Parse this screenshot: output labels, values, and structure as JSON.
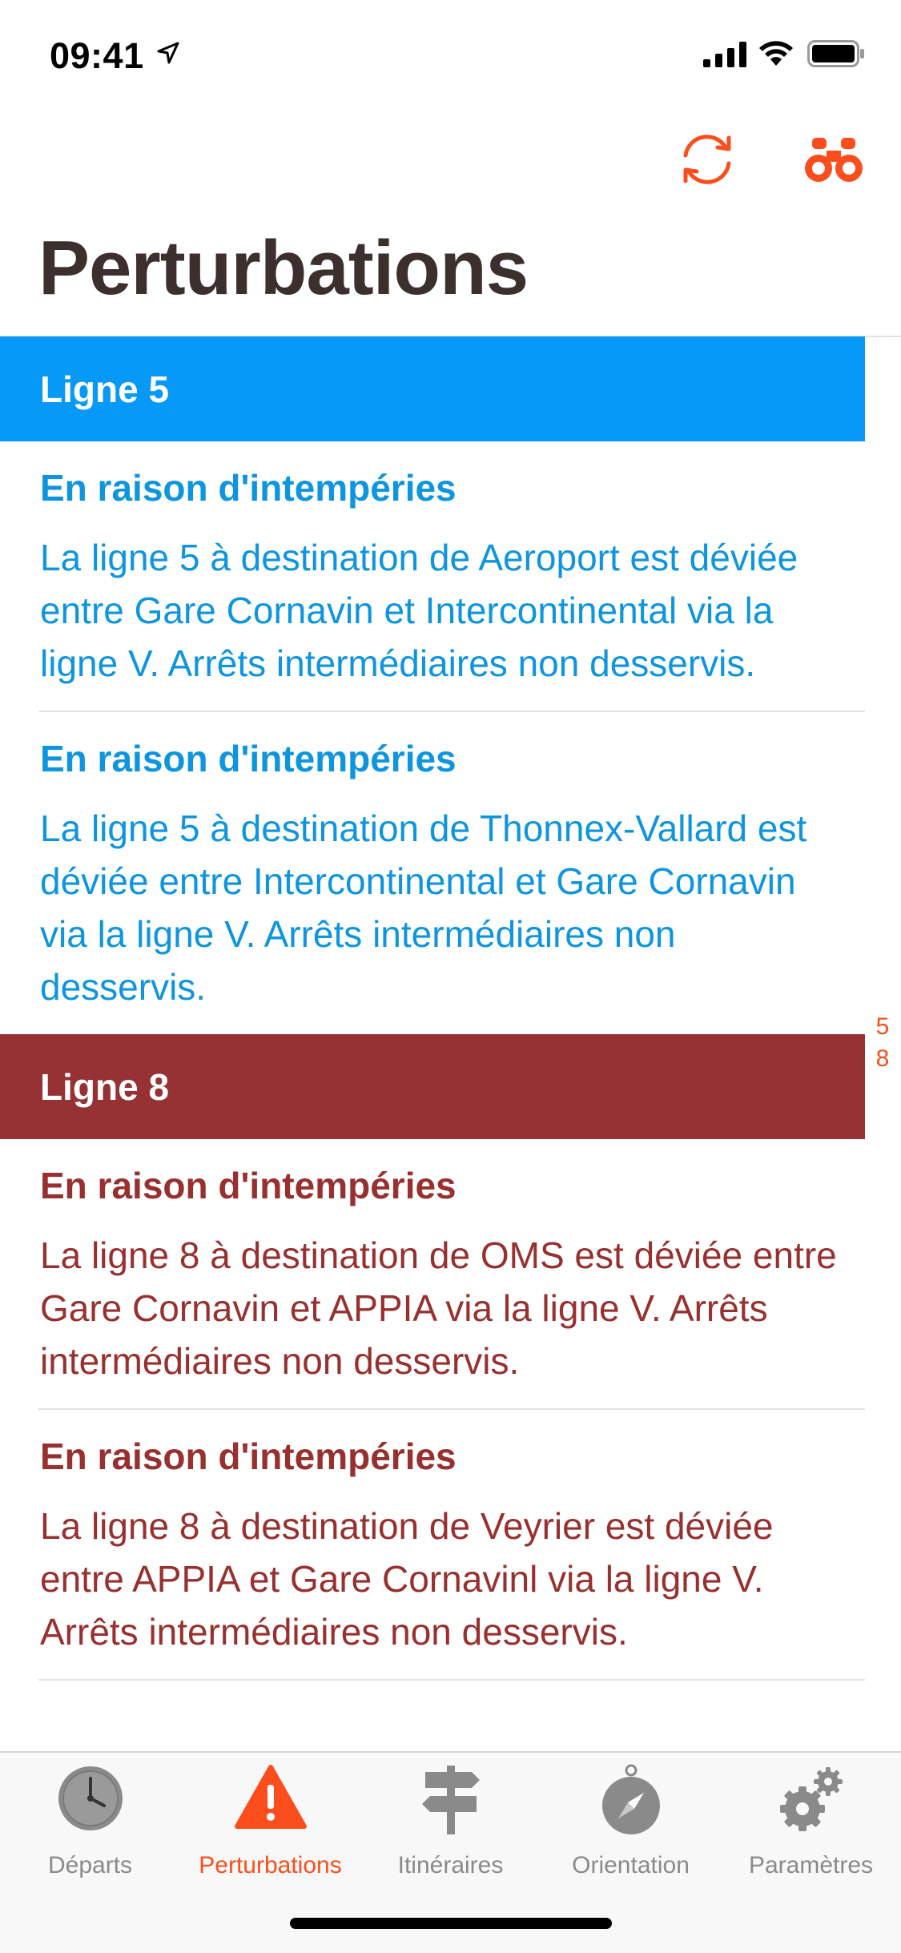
{
  "status_bar": {
    "time": "09:41"
  },
  "colors": {
    "accent": "#fb4e1c",
    "line5": "#0699f7",
    "line8": "#963234",
    "title": "#3b302e",
    "tab_inactive": "#8a8a8a"
  },
  "header": {
    "title": "Perturbations"
  },
  "sections": [
    {
      "label": "Ligne 5",
      "items": [
        {
          "title": "En raison d'intempéries",
          "text": "La ligne 5 à destination de Aeroport est déviée entre Gare Cornavin et Intercontinental via la ligne V. Arrêts intermédiaires non desservis."
        },
        {
          "title": "En raison d'intempéries",
          "text": "La ligne 5 à destination de Thonnex-Vallard est déviée entre Intercontinental et Gare Cornavin via la ligne V. Arrêts intermédiaires non desservis."
        }
      ]
    },
    {
      "label": "Ligne 8",
      "items": [
        {
          "title": "En raison d'intempéries",
          "text": "La ligne 8 à destination de OMS est déviée entre Gare Cornavin et APPIA via la ligne V. Arrêts intermédiaires non desservis."
        },
        {
          "title": "En raison d'intempéries",
          "text": "La ligne 8 à destination de Veyrier est déviée entre APPIA et Gare Cornavinl via la ligne V. Arrêts intermédiaires non desservis."
        }
      ]
    }
  ],
  "section_index": [
    "5",
    "8"
  ],
  "tabs": [
    {
      "label": "Départs",
      "icon": "clock-icon",
      "active": false
    },
    {
      "label": "Perturbations",
      "icon": "warning-icon",
      "active": true
    },
    {
      "label": "Itinéraires",
      "icon": "signpost-icon",
      "active": false
    },
    {
      "label": "Orientation",
      "icon": "compass-icon",
      "active": false
    },
    {
      "label": "Paramètres",
      "icon": "gears-icon",
      "active": false
    }
  ]
}
